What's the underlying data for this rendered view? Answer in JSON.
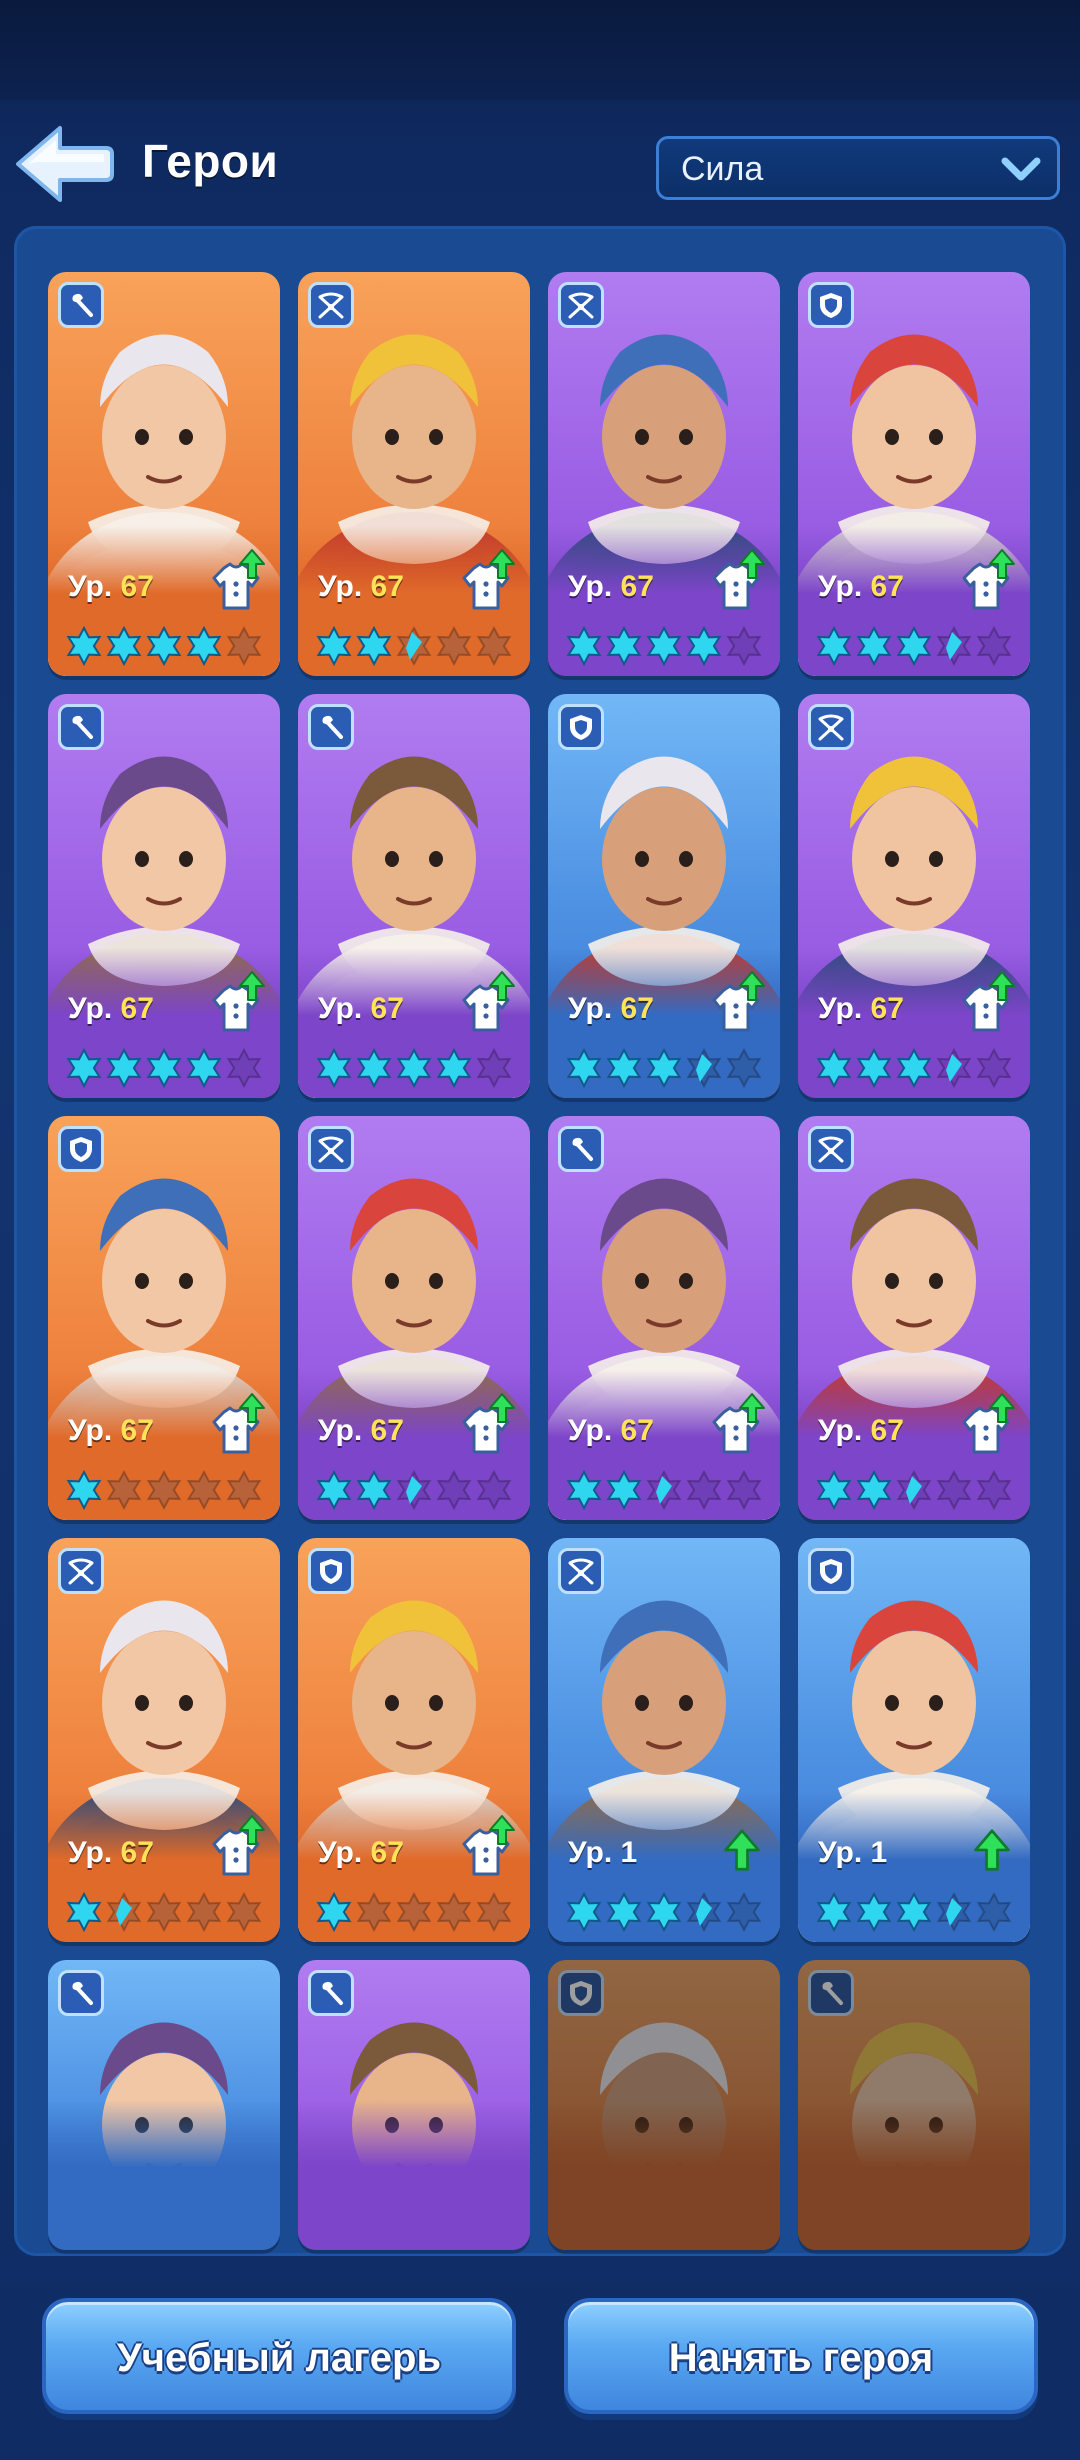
{
  "header": {
    "title": "Герои",
    "sort_value": "Сила"
  },
  "colors": {
    "orange_card": "#f08a44",
    "purple_card": "#9d62e6",
    "blue_card": "#4f93e4",
    "star_filled": "#2fd6f0",
    "star_empty_orange": "#b8623a",
    "star_empty_purple": "#6f3fb8",
    "star_empty_blue": "#2e5ea8",
    "level_number": "#ffe15a",
    "upgrade_arrow": "#2ee05a"
  },
  "heroes": [
    {
      "rarity": "orange",
      "role": "tool",
      "level_prefix": "Ур.",
      "level": "67",
      "stars": 4,
      "half": 0,
      "equip": true
    },
    {
      "rarity": "orange",
      "role": "crossbow",
      "level_prefix": "Ур.",
      "level": "67",
      "stars": 2,
      "half": 1,
      "equip": true
    },
    {
      "rarity": "purple",
      "role": "crossbow",
      "level_prefix": "Ур.",
      "level": "67",
      "stars": 4,
      "half": 0,
      "equip": true
    },
    {
      "rarity": "purple",
      "role": "shield",
      "level_prefix": "Ур.",
      "level": "67",
      "stars": 3,
      "half": 1,
      "equip": true
    },
    {
      "rarity": "purple",
      "role": "tool",
      "level_prefix": "Ур.",
      "level": "67",
      "stars": 4,
      "half": 0,
      "equip": true
    },
    {
      "rarity": "purple",
      "role": "tool",
      "level_prefix": "Ур.",
      "level": "67",
      "stars": 4,
      "half": 0,
      "equip": true
    },
    {
      "rarity": "blue",
      "role": "shield",
      "level_prefix": "Ур.",
      "level": "67",
      "stars": 3,
      "half": 1,
      "equip": true
    },
    {
      "rarity": "purple",
      "role": "crossbow",
      "level_prefix": "Ур.",
      "level": "67",
      "stars": 3,
      "half": 1,
      "equip": true
    },
    {
      "rarity": "orange",
      "role": "shield",
      "level_prefix": "Ур.",
      "level": "67",
      "stars": 1,
      "half": 0,
      "equip": true
    },
    {
      "rarity": "purple",
      "role": "crossbow",
      "level_prefix": "Ур.",
      "level": "67",
      "stars": 2,
      "half": 1,
      "equip": true
    },
    {
      "rarity": "purple",
      "role": "tool",
      "level_prefix": "Ур.",
      "level": "67",
      "stars": 2,
      "half": 1,
      "equip": true
    },
    {
      "rarity": "purple",
      "role": "crossbow",
      "level_prefix": "Ур.",
      "level": "67",
      "stars": 2,
      "half": 1,
      "equip": true
    },
    {
      "rarity": "orange",
      "role": "crossbow",
      "level_prefix": "Ур.",
      "level": "67",
      "stars": 1,
      "half": 1,
      "equip": true
    },
    {
      "rarity": "orange",
      "role": "shield",
      "level_prefix": "Ур.",
      "level": "67",
      "stars": 1,
      "half": 0,
      "equip": true
    },
    {
      "rarity": "blue",
      "role": "crossbow",
      "level_prefix": "Ур.",
      "level": "1",
      "stars": 3,
      "half": 1,
      "equip": false
    },
    {
      "rarity": "blue",
      "role": "shield",
      "level_prefix": "Ур.",
      "level": "1",
      "stars": 3,
      "half": 1,
      "equip": false
    },
    {
      "rarity": "blue",
      "role": "tool",
      "level_prefix": "",
      "level": "",
      "stars": 0,
      "half": 0,
      "equip": false,
      "partial": true
    },
    {
      "rarity": "purple",
      "role": "tool",
      "level_prefix": "",
      "level": "",
      "stars": 0,
      "half": 0,
      "equip": false,
      "partial": true
    },
    {
      "rarity": "orange",
      "role": "shield",
      "level_prefix": "",
      "level": "",
      "stars": 0,
      "half": 0,
      "equip": false,
      "partial": true,
      "locked": true
    },
    {
      "rarity": "orange",
      "role": "tool",
      "level_prefix": "",
      "level": "",
      "stars": 0,
      "half": 0,
      "equip": false,
      "partial": true,
      "locked": true
    }
  ],
  "footer": {
    "training_camp_label": "Учебный лагерь",
    "hire_hero_label": "Нанять героя"
  }
}
